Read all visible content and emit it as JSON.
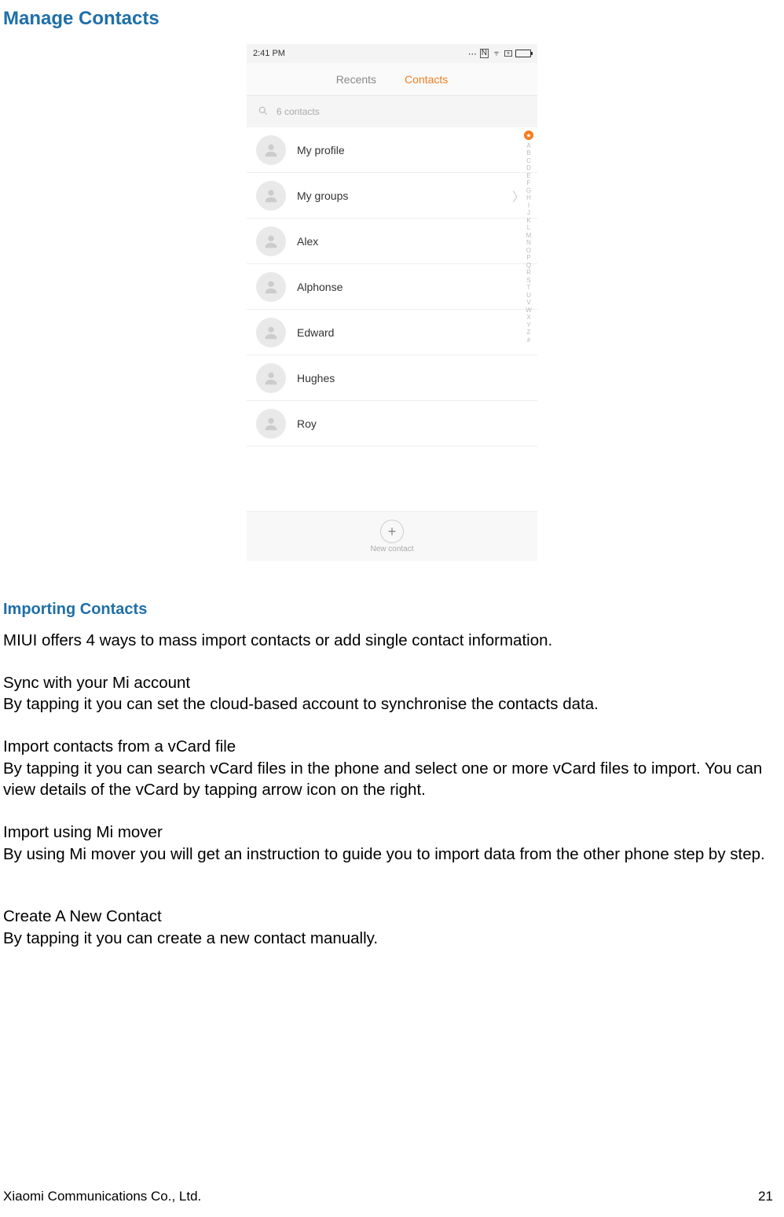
{
  "headings": {
    "manage": "Manage Contacts",
    "importing": "Importing Contacts"
  },
  "phone": {
    "status_time": "2:41 PM",
    "tabs": {
      "recents": "Recents",
      "contacts": "Contacts"
    },
    "search_text": "6 contacts",
    "rows": [
      {
        "label": "My profile",
        "chevron": false
      },
      {
        "label": "My groups",
        "chevron": true
      },
      {
        "label": "Alex",
        "chevron": false
      },
      {
        "label": "Alphonse",
        "chevron": false
      },
      {
        "label": "Edward",
        "chevron": false
      },
      {
        "label": "Hughes",
        "chevron": false
      },
      {
        "label": "Roy",
        "chevron": false
      }
    ],
    "index_letters": [
      "A",
      "B",
      "C",
      "D",
      "E",
      "F",
      "G",
      "H",
      "I",
      "J",
      "K",
      "L",
      "M",
      "N",
      "O",
      "P",
      "Q",
      "R",
      "S",
      "T",
      "U",
      "V",
      "W",
      "X",
      "Y",
      "Z",
      "#"
    ],
    "new_contact_label": "New contact"
  },
  "body": {
    "intro": "MIUI offers 4 ways to mass import contacts or add single contact information.",
    "sync_h": "Sync with your Mi account",
    "sync_b": "By tapping it you can set the cloud-based account to synchronise the contacts data.",
    "vcard_h": "Import contacts from a vCard file",
    "vcard_b": "By tapping it you can search vCard files in the phone and select one or more vCard files to import. You can view details of the vCard by tapping arrow icon on the right.",
    "mover_h": "Import using Mi mover",
    "mover_b": "By using Mi mover you will get an instruction to guide you to import data from the other phone step by step.",
    "create_h": "Create A New Contact",
    "create_b": "By tapping it you can create a new contact manually."
  },
  "footer": {
    "company": "Xiaomi Communications Co., Ltd.",
    "page": "21"
  }
}
